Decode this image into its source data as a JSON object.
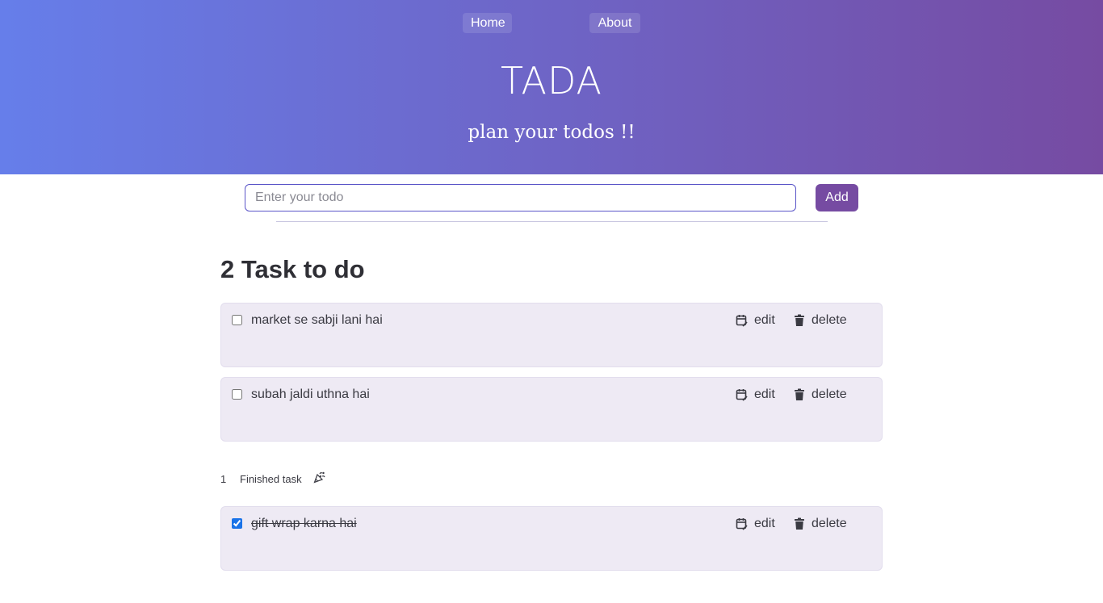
{
  "nav": {
    "home_label": "Home",
    "about_label": "About"
  },
  "header": {
    "title": "TADA",
    "subtitle": "plan your todos !!"
  },
  "input": {
    "placeholder": "Enter your todo",
    "value": ""
  },
  "add_button_label": "Add",
  "pending": {
    "count": "2",
    "heading_suffix": "Task to do",
    "tasks": [
      {
        "text": "market se sabji lani hai",
        "checked": false,
        "edit_label": "edit",
        "delete_label": "delete"
      },
      {
        "text": "subah jaldi uthna hai",
        "checked": false,
        "edit_label": "edit",
        "delete_label": "delete"
      }
    ]
  },
  "finished": {
    "count": "1",
    "label": "Finished task",
    "icon": "party-popper-icon",
    "tasks": [
      {
        "text": "gift wrap karna hai",
        "checked": true,
        "edit_label": "edit",
        "delete_label": "delete"
      }
    ]
  },
  "colors": {
    "gradient_start": "#667eea",
    "gradient_end": "#764ba2",
    "add_button": "#764ba2",
    "card_bg": "#eeeaf4"
  }
}
